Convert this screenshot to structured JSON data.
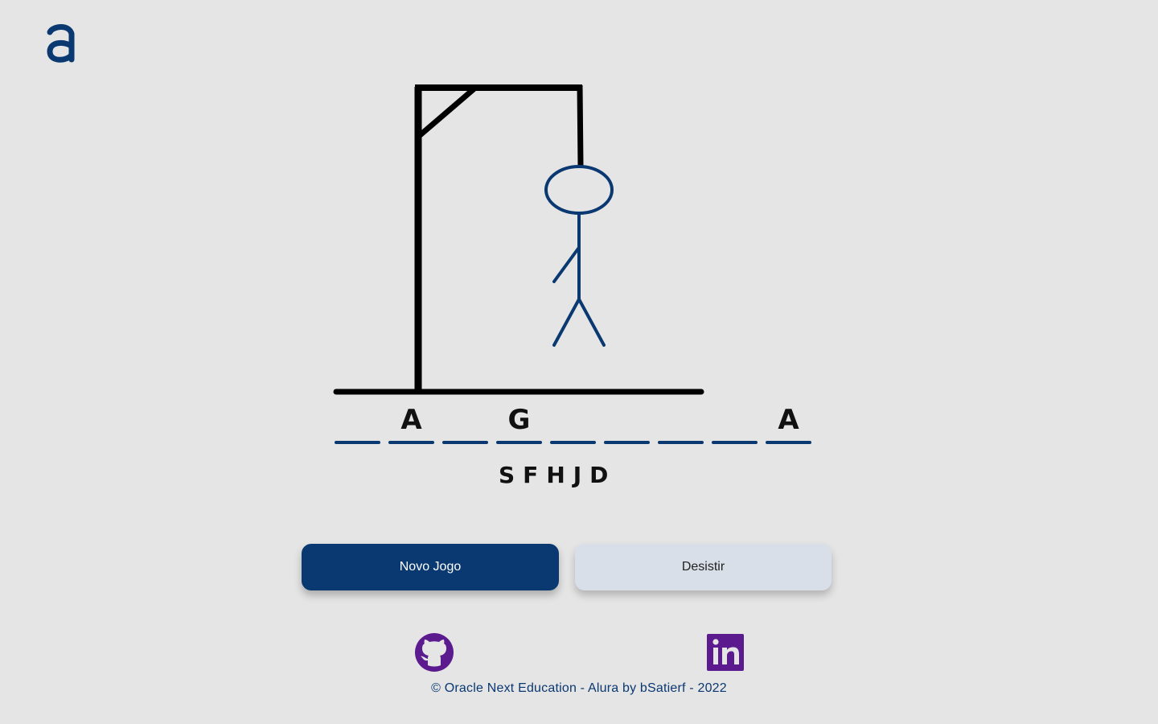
{
  "header": {
    "logo_icon": "alura-logo-icon"
  },
  "game": {
    "word_slots": [
      "",
      "A",
      "",
      "G",
      "",
      "",
      "",
      "",
      "A"
    ],
    "wrong_letters": [
      "S",
      "F",
      "H",
      "J",
      "D"
    ],
    "drawn_parts": [
      "gallows",
      "head",
      "body",
      "left-arm",
      "left-leg",
      "right-leg"
    ]
  },
  "buttons": {
    "new_game_label": "Novo Jogo",
    "give_up_label": "Desistir"
  },
  "social": {
    "github_icon": "github-icon",
    "linkedin_icon": "linkedin-icon"
  },
  "footer": {
    "text": "© Oracle Next Education - Alura by bSatierf - 2022"
  },
  "colors": {
    "background": "#e5e5e5",
    "brand": "#0a3871",
    "secondary_button": "#d8dfe8",
    "social_purple": "#5b1b8f",
    "gallows": "#000000"
  }
}
